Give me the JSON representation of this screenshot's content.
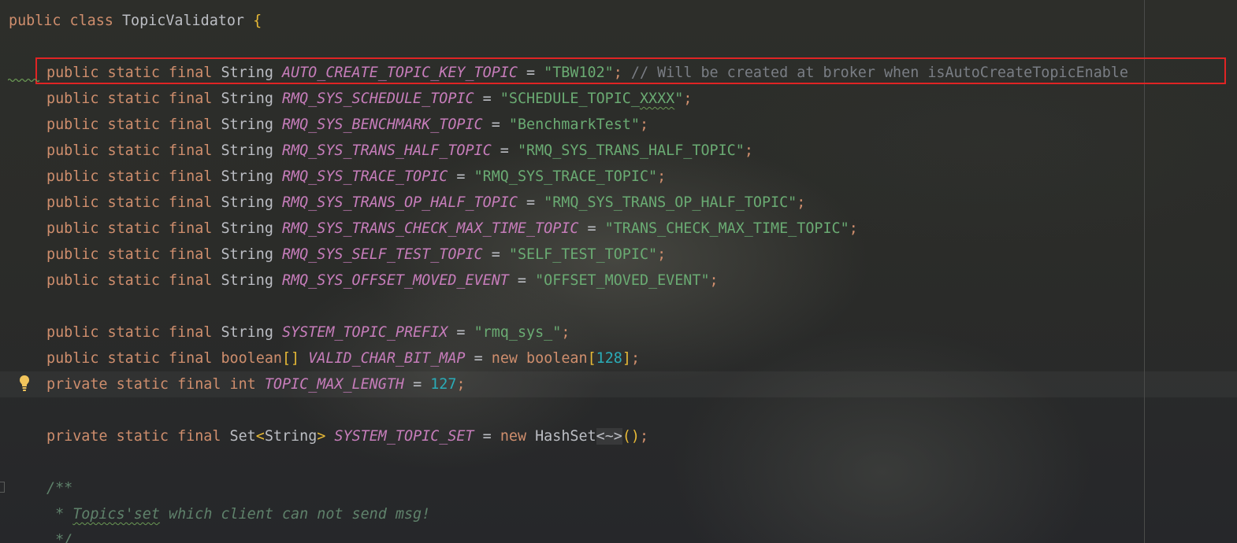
{
  "editor": {
    "class_decl": {
      "kw1": "public",
      "kw2": "class",
      "name": "TopicValidator",
      "brace": "{"
    },
    "fields": [
      {
        "mods": "public static final",
        "type": "String",
        "name": "AUTO_CREATE_TOPIC_KEY_TOPIC",
        "value": "\"TBW102\"",
        "comment": "// Will be created at broker when isAutoCreateTopicEnable"
      },
      {
        "mods": "public static final",
        "type": "String",
        "name": "RMQ_SYS_SCHEDULE_TOPIC",
        "value_pre": "\"SCHEDULE_TOPIC_",
        "value_squiggle": "XXXX",
        "value_post": "\""
      },
      {
        "mods": "public static final",
        "type": "String",
        "name": "RMQ_SYS_BENCHMARK_TOPIC",
        "value": "\"BenchmarkTest\""
      },
      {
        "mods": "public static final",
        "type": "String",
        "name": "RMQ_SYS_TRANS_HALF_TOPIC",
        "value": "\"RMQ_SYS_TRANS_HALF_TOPIC\""
      },
      {
        "mods": "public static final",
        "type": "String",
        "name": "RMQ_SYS_TRACE_TOPIC",
        "value": "\"RMQ_SYS_TRACE_TOPIC\""
      },
      {
        "mods": "public static final",
        "type": "String",
        "name": "RMQ_SYS_TRANS_OP_HALF_TOPIC",
        "value": "\"RMQ_SYS_TRANS_OP_HALF_TOPIC\""
      },
      {
        "mods": "public static final",
        "type": "String",
        "name": "RMQ_SYS_TRANS_CHECK_MAX_TIME_TOPIC",
        "value": "\"TRANS_CHECK_MAX_TIME_TOPIC\""
      },
      {
        "mods": "public static final",
        "type": "String",
        "name": "RMQ_SYS_SELF_TEST_TOPIC",
        "value": "\"SELF_TEST_TOPIC\""
      },
      {
        "mods": "public static final",
        "type": "String",
        "name": "RMQ_SYS_OFFSET_MOVED_EVENT",
        "value": "\"OFFSET_MOVED_EVENT\""
      }
    ],
    "prefix_field": {
      "mods": "public static final",
      "type": "String",
      "name": "SYSTEM_TOPIC_PREFIX",
      "value": "\"rmq_sys_\""
    },
    "bitmap_field": {
      "mods": "public static final",
      "type": "boolean",
      "arr": "[]",
      "name": "VALID_CHAR_BIT_MAP",
      "new_kw": "new",
      "new_type": "boolean",
      "lbr": "[",
      "size": "128",
      "rbr": "]"
    },
    "maxlen_field": {
      "mods": "private static final",
      "type": "int",
      "name": "TOPIC_MAX_LENGTH",
      "value": "127"
    },
    "set_field": {
      "mods": "private static final",
      "type_outer": "Set",
      "type_lt": "<",
      "type_inner": "String",
      "type_gt": ">",
      "name": "SYSTEM_TOPIC_SET",
      "new_kw": "new",
      "new_type": "HashSet",
      "diamond": "<~>",
      "parens": "()"
    },
    "javadoc": {
      "open": "/**",
      "star": " * ",
      "link_text": "Topics'set",
      "rest": " which client can not send msg!",
      "close": " */"
    },
    "symbols": {
      "eq": "=",
      "semi": ";"
    },
    "icons": {
      "intention": "lightbulb-icon"
    },
    "colors": {
      "keyword": "#cf8e6d",
      "field": "#c77dbb",
      "string": "#6aab73",
      "number": "#2aacb8",
      "comment": "#7a7e85",
      "highlight": "#e02424"
    }
  }
}
